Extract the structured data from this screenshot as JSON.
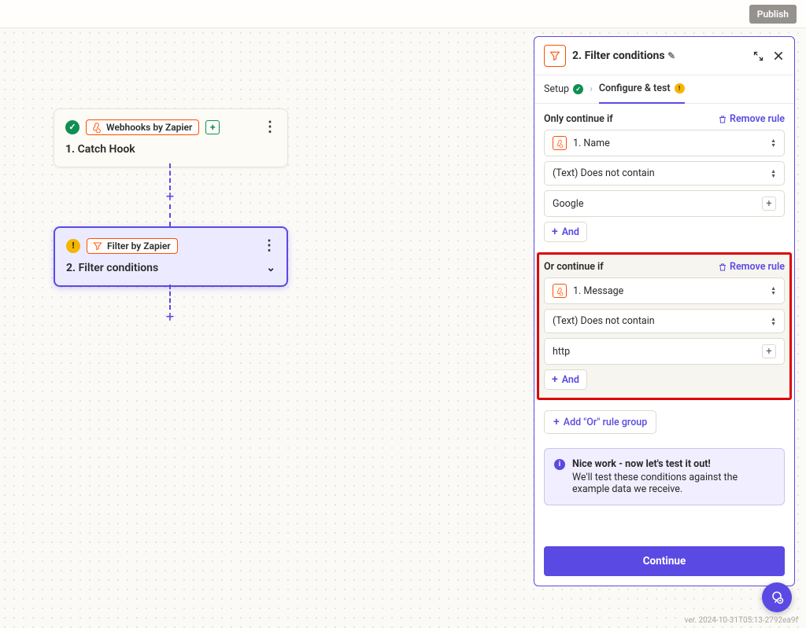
{
  "topbar": {
    "publish": "Publish"
  },
  "steps": [
    {
      "app_label": "Webhooks by Zapier",
      "num": "1.",
      "title": "Catch Hook",
      "status": "ok",
      "has_green_plus": true
    },
    {
      "app_label": "Filter by Zapier",
      "num": "2.",
      "title": "Filter conditions",
      "status": "warn",
      "has_chevron": true
    }
  ],
  "panel": {
    "header_num": "2.",
    "header_title": "Filter conditions",
    "crumb1": "Setup",
    "crumb2": "Configure & test",
    "rule_groups": [
      {
        "label": "Only continue if",
        "remove": "Remove rule",
        "field_label": "1. Name",
        "condition": "(Text) Does not contain",
        "value": "Google",
        "and": "And",
        "highlighted": false
      },
      {
        "label": "Or continue if",
        "remove": "Remove rule",
        "field_label": "1. Message",
        "condition": "(Text) Does not contain",
        "value": "http",
        "and": "And",
        "highlighted": true
      }
    ],
    "add_or": "Add \"Or\" rule group",
    "banner_title": "Nice work - now let's test it out!",
    "banner_body": "We'll test these conditions against the example data we receive.",
    "continue": "Continue"
  },
  "version": "ver. 2024-10-31T05:13-2792ea9f"
}
